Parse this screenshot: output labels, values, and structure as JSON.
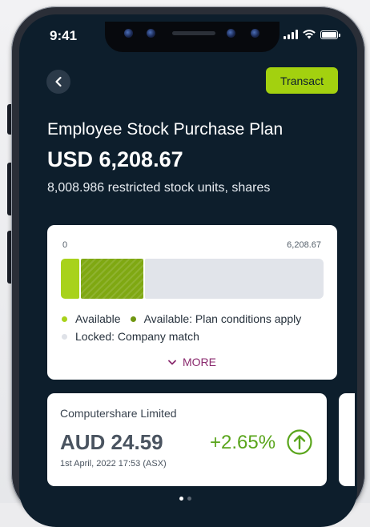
{
  "status_bar": {
    "time": "9:41"
  },
  "header": {
    "transact_label": "Transact"
  },
  "plan": {
    "title": "Employee Stock Purchase Plan",
    "amount": "USD 6,208.67",
    "units": "8,008.986 restricted stock units, shares"
  },
  "balance_chart": {
    "scale_min": "0",
    "scale_max": "6,208.67",
    "colors": {
      "available": "#a8d21b",
      "conditions": "#7fa812",
      "locked": "#e1e4ea"
    },
    "legend": {
      "available": "Available",
      "conditions": "Available: Plan conditions apply",
      "locked": "Locked: Company match"
    },
    "more_label": "MORE"
  },
  "stock": {
    "company": "Computershare Limited",
    "price": "AUD 24.59",
    "timestamp": "1st April, 2022 17:53 (ASX)",
    "change": "+2.65%",
    "change_color": "#5aa51c",
    "trend_icon": "arrow-up-circle-icon"
  },
  "pager": {
    "pages": 2,
    "active_index": 0
  }
}
